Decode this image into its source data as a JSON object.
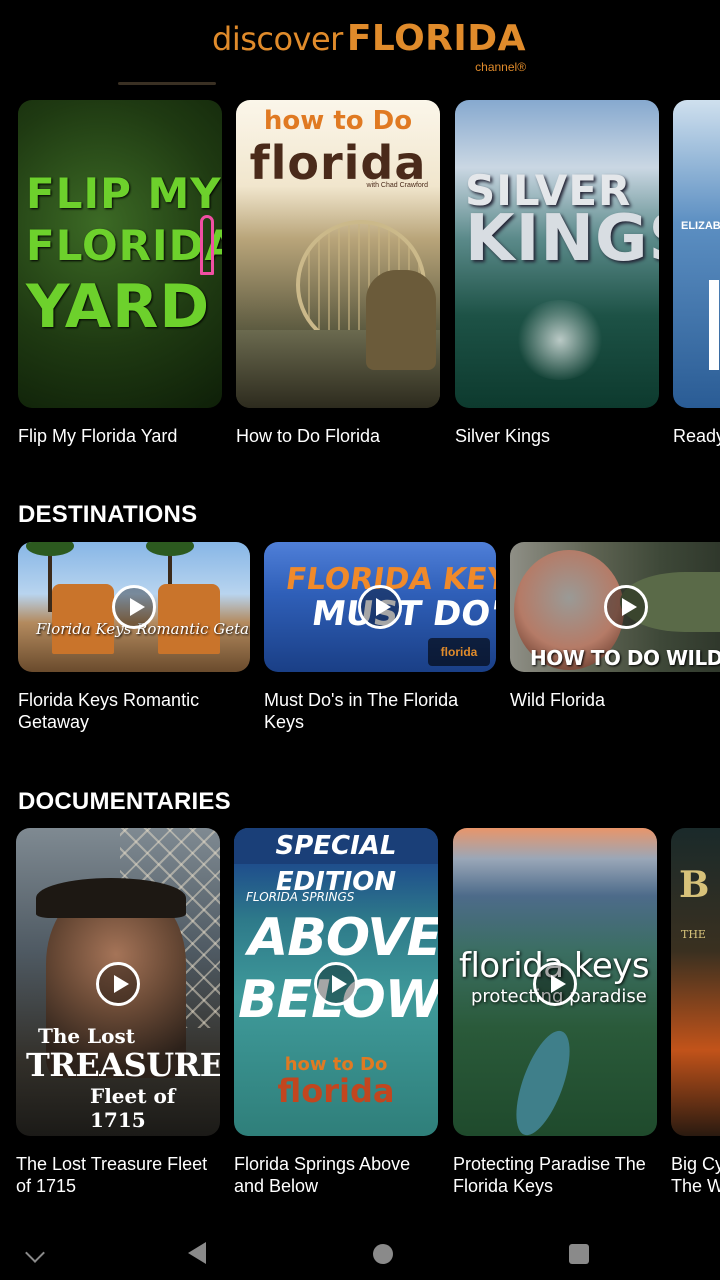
{
  "header": {
    "logo_discover": "discover",
    "logo_florida": "FLORIDA",
    "logo_channel": "channel®",
    "brand_color": "#e08b2b"
  },
  "featured": {
    "items": [
      {
        "title": "Flip My Florida Yard",
        "art_lines": [
          "FLIP MY",
          "FLORIDA",
          "YARD"
        ]
      },
      {
        "title": "How to Do Florida",
        "art_top": "how to Do",
        "art_main": "florida",
        "art_sub": "with Chad Crawford"
      },
      {
        "title": "Silver Kings",
        "art_top": "SILVER",
        "art_main": "KINGS"
      },
      {
        "title": "Ready",
        "art_top": "ELIZABE"
      }
    ]
  },
  "destinations": {
    "heading": "DESTINATIONS",
    "items": [
      {
        "title": "Florida Keys Romantic Getaway",
        "art": "Florida Keys Romantic Getaway",
        "icon": "play-icon"
      },
      {
        "title": "Must Do's in The Florida Keys",
        "art_top": "FLORIDA KEYS",
        "art_main": "MUST DO'S",
        "art_badge": "florida",
        "icon": "play-icon"
      },
      {
        "title": "Wild Florida",
        "art": "HOW TO DO WILD FLORIDA",
        "icon": "play-icon"
      }
    ]
  },
  "documentaries": {
    "heading": "DOCUMENTARIES",
    "items": [
      {
        "title": "The Lost Treasure Fleet of 1715",
        "art_l1": "The Lost",
        "art_l2": "TREASURE",
        "art_l3": "Fleet of 1715",
        "icon": "play-icon"
      },
      {
        "title": "Florida Springs Above and Below",
        "art_banner": "SPECIAL EDITION",
        "art_small": "FLORIDA SPRINGS",
        "art_l1": "ABOVE",
        "art_l2": "BELOW",
        "art_how": "how to Do",
        "art_flo": "florida",
        "icon": "play-icon"
      },
      {
        "title": "Protecting Paradise The Florida Keys",
        "art_l1": "florida keys",
        "art_l2": "protecting paradise",
        "icon": "play-icon"
      },
      {
        "title": "Big Cy... The W...",
        "art_l1": "B",
        "art_l2": "THE"
      }
    ],
    "cut_title_line1": "Big Cy",
    "cut_title_line2": "The W"
  },
  "navbar": {
    "icons": [
      "chevron-down-icon",
      "back-icon",
      "home-icon",
      "recent-apps-icon"
    ]
  }
}
